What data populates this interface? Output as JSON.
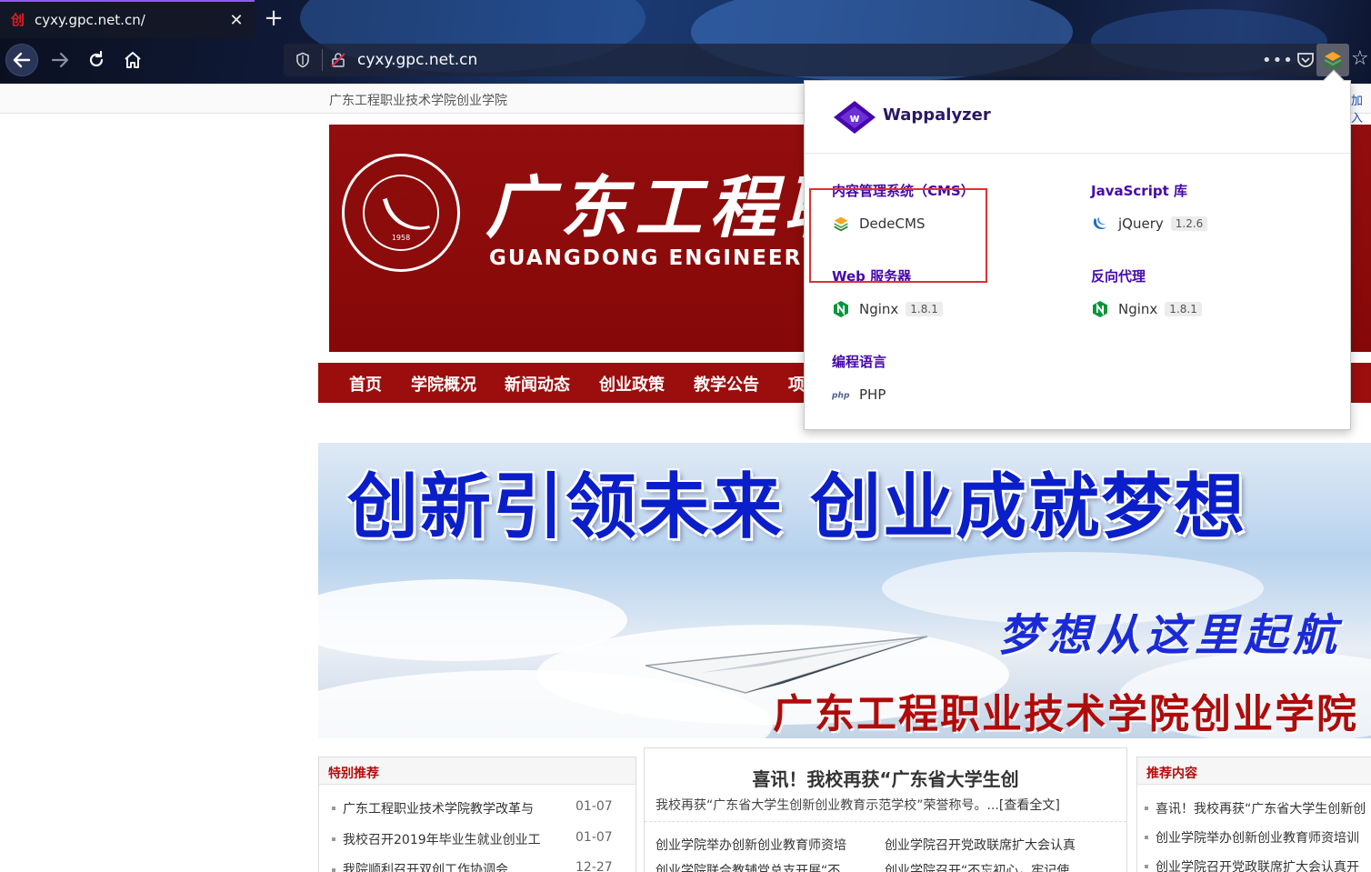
{
  "browser": {
    "tab_title": "cyxy.gpc.net.cn/",
    "tab_favicon_glyph": "创",
    "new_tab_glyph": "+",
    "close_glyph": "✕",
    "url": "cyxy.gpc.net.cn",
    "more_glyph": "•••",
    "star_glyph": "☆",
    "accent": "#9059ff"
  },
  "page": {
    "site_subtitle": "广东工程职业技术学院创业学院",
    "join_link": "加入",
    "banner_cn": "广东工程职业",
    "banner_en": "GUANGDONG   ENGINEERI",
    "logo_year": "1958",
    "nav": [
      "首页",
      "学院概况",
      "新闻动态",
      "创业政策",
      "教学公告",
      "项"
    ],
    "hero_title": "创新引领未来  创业成就梦想",
    "hero_slogan": "梦想从这里起航",
    "hero_school": "广东工程职业技术学院创业学院",
    "featured": {
      "heading": "特别推荐",
      "items": [
        {
          "title": "广东工程职业技术学院教学改革与",
          "date": "01-07"
        },
        {
          "title": "我校召开2019年毕业生就业创业工",
          "date": "01-07"
        },
        {
          "title": "我院顺利召开双创工作协调会",
          "date": "12-27"
        }
      ]
    },
    "news": {
      "headline": "喜讯！我校再获“广东省大学生创",
      "summary": "我校再获“广东省大学生创新创业教育示范学校”荣誉称号。...",
      "more": "[查看全文]",
      "links": [
        "创业学院举办创新创业教育师资培",
        "创业学院召开党政联席扩大会认真",
        "创业学院联合教辅党总支开展“不",
        "创业学院召开“不忘初心，牢记使"
      ]
    },
    "recommended": {
      "heading": "推荐内容",
      "items": [
        "喜讯！我校再获“广东省大学生创新创",
        "创业学院举办创新创业教育师资培训",
        "创业学院召开党政联席扩大会认真开"
      ]
    }
  },
  "wappalyzer": {
    "brand": "Wappalyzer",
    "brand_color": "#4608ad",
    "categories": [
      {
        "name": "内容管理系统（CMS）",
        "techs": [
          {
            "name": "DedeCMS",
            "version": "",
            "icon": "dedecms-icon"
          }
        ]
      },
      {
        "name": "JavaScript 库",
        "techs": [
          {
            "name": "jQuery",
            "version": "1.2.6",
            "icon": "jquery-icon"
          }
        ]
      },
      {
        "name": "Web 服务器",
        "techs": [
          {
            "name": "Nginx",
            "version": "1.8.1",
            "icon": "nginx-icon"
          }
        ]
      },
      {
        "name": "反向代理",
        "techs": [
          {
            "name": "Nginx",
            "version": "1.8.1",
            "icon": "nginx-icon"
          }
        ]
      },
      {
        "name": "编程语言",
        "techs": [
          {
            "name": "PHP",
            "version": "",
            "icon": "php-icon"
          }
        ]
      }
    ],
    "highlight_color": "#e03030"
  }
}
